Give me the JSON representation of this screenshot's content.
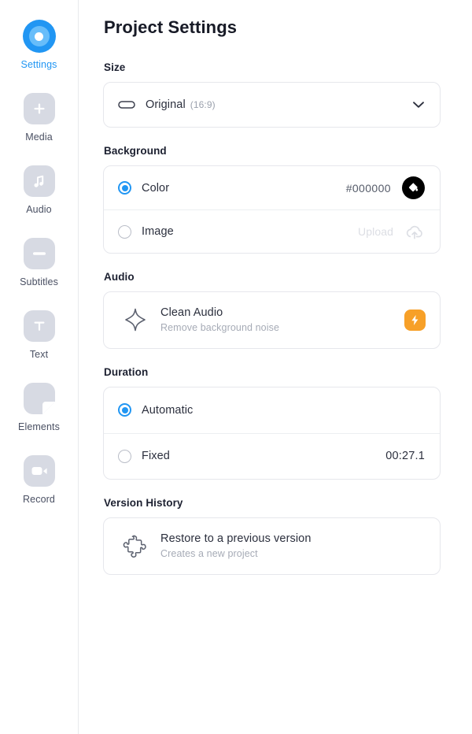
{
  "sidebar": {
    "items": [
      {
        "label": "Settings",
        "icon": "settings-target-icon",
        "active": true
      },
      {
        "label": "Media",
        "icon": "plus-icon",
        "active": false
      },
      {
        "label": "Audio",
        "icon": "music-note-icon",
        "active": false
      },
      {
        "label": "Subtitles",
        "icon": "subtitles-icon",
        "active": false
      },
      {
        "label": "Text",
        "icon": "text-t-icon",
        "active": false
      },
      {
        "label": "Elements",
        "icon": "shapes-icon",
        "active": false
      },
      {
        "label": "Record",
        "icon": "video-camera-icon",
        "active": false
      }
    ]
  },
  "page": {
    "title": "Project Settings"
  },
  "size": {
    "label": "Size",
    "selected": "Original",
    "ratio": "(16:9)",
    "chevron_icon": "chevron-down-icon",
    "aspect_icon": "aspect-ratio-icon"
  },
  "background": {
    "label": "Background",
    "color": {
      "label": "Color",
      "value": "#000000",
      "selected": true,
      "swatch_color": "#000000",
      "swatch_icon": "paint-bucket-icon"
    },
    "image": {
      "label": "Image",
      "upload_label": "Upload",
      "selected": false,
      "upload_icon": "cloud-upload-icon"
    }
  },
  "audio": {
    "label": "Audio",
    "clean_audio": {
      "title": "Clean Audio",
      "subtitle": "Remove background noise",
      "icon": "sparkle-icon",
      "badge_icon": "lightning-bolt-icon",
      "badge_color": "#F7A028"
    }
  },
  "duration": {
    "label": "Duration",
    "automatic": {
      "label": "Automatic",
      "selected": true
    },
    "fixed": {
      "label": "Fixed",
      "value": "00:27.1",
      "selected": false
    }
  },
  "version_history": {
    "label": "Version History",
    "restore": {
      "title": "Restore to a previous version",
      "subtitle": "Creates a new project",
      "icon": "puzzle-piece-icon"
    }
  },
  "theme": {
    "accent": "#2196F3",
    "border": "#E6E7EC",
    "muted_text": "#9BA1AD"
  }
}
